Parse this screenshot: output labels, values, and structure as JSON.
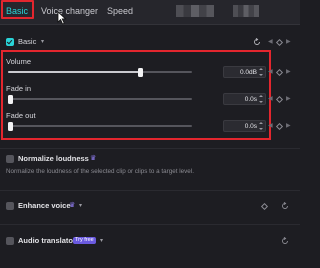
{
  "tabs": [
    {
      "label": "Basic",
      "active": true
    },
    {
      "label": "Voice changer",
      "active": false
    },
    {
      "label": "Speed",
      "active": false
    }
  ],
  "basic": {
    "label": "Basic",
    "controls": [
      {
        "label": "Volume",
        "value": "0.0dB",
        "level": 0.72
      },
      {
        "label": "Fade in",
        "value": "0.0s",
        "level": 0.0
      },
      {
        "label": "Fade out",
        "value": "0.0s",
        "level": 0.0
      }
    ]
  },
  "normalize": {
    "label": "Normalize loudness",
    "description": "Normalize the loudness of the selected clip or clips to a target level."
  },
  "enhance": {
    "label": "Enhance voice"
  },
  "translator": {
    "label": "Audio translator",
    "badge": "Try free"
  },
  "colors": {
    "accent": "#2ad4d8",
    "highlight": "#e3262e",
    "pro_badge": "#6a5adf"
  }
}
